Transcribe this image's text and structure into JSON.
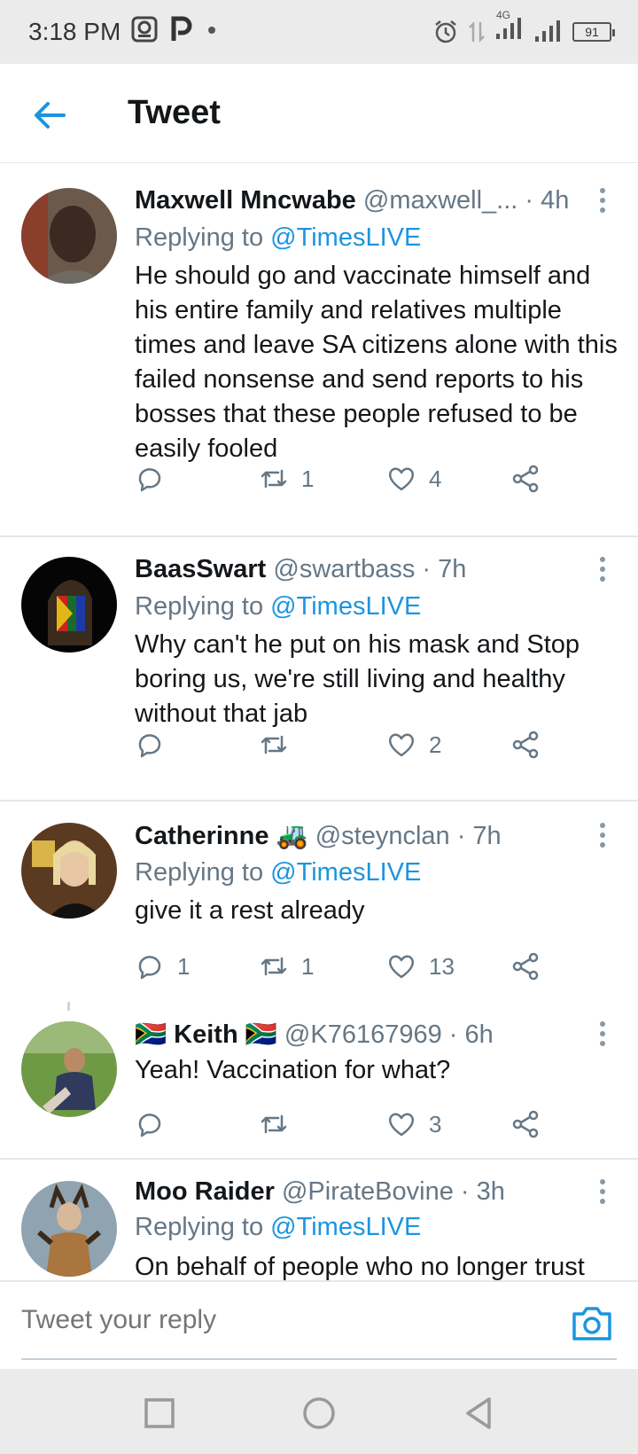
{
  "status_bar": {
    "time": "3:18 PM",
    "network": "4G",
    "battery": "91",
    "icons": [
      "photo-notification-icon",
      "p-app-icon",
      "dot-icon",
      "alarm-icon",
      "data-arrows-icon",
      "signal-icon",
      "signal-icon",
      "battery-icon"
    ]
  },
  "header": {
    "title": "Tweet",
    "back_icon": "arrow-left-icon"
  },
  "tweets": [
    {
      "name": "Maxwell Mncwabe",
      "handle": "@maxwell_...",
      "time": "· 4h",
      "replying_prefix": "Replying to",
      "replying_to": "@TimesLIVE",
      "text": "He should go and vaccinate himself and his entire family and relatives multiple times and leave SA citizens alone with this failed nonsense and send reports to his bosses that these people refused to be easily fooled",
      "replies": "",
      "retweets": "1",
      "likes": "4"
    },
    {
      "name": "BaasSwart",
      "handle": "@swartbass",
      "time": "· 7h",
      "replying_prefix": "Replying to",
      "replying_to": "@TimesLIVE",
      "text": "Why can't he put on his mask and Stop boring us, we're still living and healthy without that jab",
      "replies": "",
      "retweets": "",
      "likes": "2"
    },
    {
      "name": "Catherinne 🚜",
      "handle": "@steynclan",
      "time": "· 7h",
      "replying_prefix": "Replying to",
      "replying_to": "@TimesLIVE",
      "text": "give it a rest already",
      "replies": "1",
      "retweets": "1",
      "likes": "13"
    },
    {
      "name": "🇿🇦 Keith 🇿🇦",
      "handle": "@K76167969",
      "time": "· 6h",
      "text": "Yeah! Vaccination for what?",
      "replies": "",
      "retweets": "",
      "likes": "3"
    },
    {
      "name": "Moo Raider",
      "handle": "@PirateBovine",
      "time": "· 3h",
      "replying_prefix": "Replying to",
      "replying_to": "@TimesLIVE",
      "text": "On behalf of people who no longer trust"
    }
  ],
  "reply_bar": {
    "placeholder": "Tweet your reply",
    "camera_icon": "camera-icon"
  },
  "nav_bar": {
    "icons": [
      "recents-square-icon",
      "home-circle-icon",
      "back-triangle-icon"
    ]
  },
  "colors": {
    "accent": "#1b95e0",
    "secondary_text": "#657786",
    "primary_text": "#14171a",
    "divider": "#e1e8ed",
    "system_bar": "#ebebeb"
  }
}
